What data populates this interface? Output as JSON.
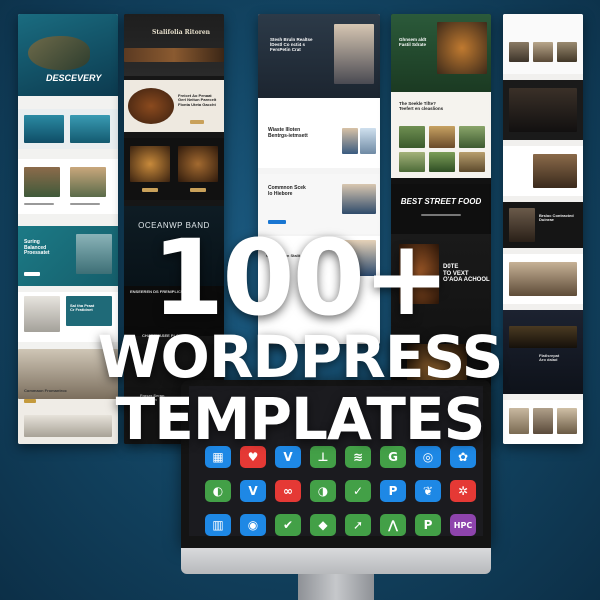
{
  "headline": {
    "line1": "100+",
    "line2": "WORDPRESS",
    "line3": "TEMPLATES"
  },
  "templates": {
    "col1": {
      "hero_title": "DESCEVERY",
      "section_title": "Suring\nBalanced\nProessatet",
      "feature_title": "Sal tha Praat\nCr Fratidnet",
      "footer_title": "Commaon Fromantroc"
    },
    "col2": {
      "hero_title": "Stalifolia Ritoren",
      "sub_title": "Freicet Ao Penaat\nGerl Neitun Parecelt\nFlonta Uteta Gaccht",
      "brand_title": "OCEANWP BAND",
      "event_title": "ENSEEREN DS FRENIPLICUS",
      "bottom_title": "CHASSKASEE PLONS",
      "footer_title": "Fraser Seran\nMorcrien"
    },
    "col3": {
      "hero_title": "Stesh Bruln Realtse\nlDestl Co ncti4 s\nFersPetin Crat",
      "section_title": "Wiaste lIloten\nBentrgs-ietmsett",
      "feature_title": "Commnon Scek\nlo Hiebore",
      "footer_title": "Comnedtion Stalit"
    },
    "col4": {
      "hero_title": "Ghnsem aldt\nFastil Sdrate",
      "section_title": "The Seekle Tifte?\nTeefert en cleaslions",
      "food_title": "BEST STREET FOOD",
      "food_sub": "D0TE\nTO VEXT\nO'AOA ACHOOL"
    },
    "col5": {
      "card_title": "Brsloc Contracted\nDuinrae",
      "bottom_title": "Flatlsrepat\nAro dalad"
    }
  },
  "apps": [
    {
      "icon": "grid-icon",
      "glyph": "▦",
      "color": "#1e88e5"
    },
    {
      "icon": "heart-icon",
      "glyph": "♥",
      "color": "#e53935"
    },
    {
      "icon": "v-icon",
      "glyph": "V",
      "color": "#1e88e5"
    },
    {
      "icon": "trident-icon",
      "glyph": "⊥",
      "color": "#43a047"
    },
    {
      "icon": "wave-icon",
      "glyph": "≋",
      "color": "#43a047"
    },
    {
      "icon": "g-icon",
      "glyph": "G",
      "color": "#43a047"
    },
    {
      "icon": "signal-icon",
      "glyph": "◎",
      "color": "#1e88e5"
    },
    {
      "icon": "settings-icon",
      "glyph": "✿",
      "color": "#1e88e5"
    },
    {
      "icon": "leaf-icon",
      "glyph": "◐",
      "color": "#43a047"
    },
    {
      "icon": "vw-icon",
      "glyph": "V",
      "color": "#1e88e5"
    },
    {
      "icon": "rings-icon",
      "glyph": "∞",
      "color": "#e53935"
    },
    {
      "icon": "leaf-2-icon",
      "glyph": "◑",
      "color": "#43a047"
    },
    {
      "icon": "check-leaf-icon",
      "glyph": "✓",
      "color": "#43a047"
    },
    {
      "icon": "p-icon",
      "glyph": "P",
      "color": "#1e88e5"
    },
    {
      "icon": "heart-2-icon",
      "glyph": "❦",
      "color": "#1e88e5"
    },
    {
      "icon": "gear-icon",
      "glyph": "✲",
      "color": "#e53935"
    },
    {
      "icon": "chart-icon",
      "glyph": "▥",
      "color": "#1e88e5"
    },
    {
      "icon": "swirl-icon",
      "glyph": "◉",
      "color": "#1e88e5"
    },
    {
      "icon": "check-icon",
      "glyph": "✔",
      "color": "#43a047"
    },
    {
      "icon": "shield-icon",
      "glyph": "◆",
      "color": "#43a047"
    },
    {
      "icon": "arrow-icon",
      "glyph": "➚",
      "color": "#43a047"
    },
    {
      "icon": "mountain-icon",
      "glyph": "⋀",
      "color": "#43a047"
    },
    {
      "icon": "p-square-icon",
      "glyph": "P",
      "color": "#43a047"
    },
    {
      "icon": "hpc-icon",
      "glyph": "HPC",
      "color": "#8e44ad"
    }
  ]
}
